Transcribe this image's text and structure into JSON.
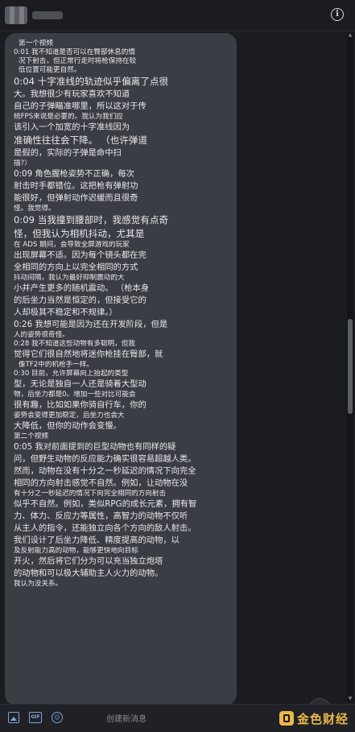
{
  "header": {
    "info_label": "i"
  },
  "message": {
    "lines": [
      {
        "t": "第一个视频",
        "c": "s ind"
      },
      {
        "t": "0:01 我不知道是否可以在臀部休息的情",
        "c": "s"
      },
      {
        "t": "况下射击，但正常行走时将枪保持在较",
        "c": "s ind"
      },
      {
        "t": "低位置可能更自然。",
        "c": "s ind"
      },
      {
        "t": "0:04 十字准线的轨迹似乎偏离了点很",
        "c": "l"
      },
      {
        "t": "大。我想很少有玩家喜欢不知道",
        "c": "m"
      },
      {
        "t": "自己的子弹瞄准哪里，所以这对于传",
        "c": "m"
      },
      {
        "t": "统FPS来说是必要的。我认为我们应",
        "c": "s"
      },
      {
        "t": "该引入一个加宽的十字准线因为",
        "c": "m"
      },
      {
        "t": "准确性往往会下降。  （也许弹道",
        "c": "l"
      },
      {
        "t": "是假的，实际的子弹是命中扫",
        "c": "m"
      },
      {
        "t": "描?）",
        "c": "s"
      },
      {
        "t": "0:09 角色握枪姿势不正确，每次",
        "c": "m"
      },
      {
        "t": "射击时手都错位。这把枪有弹射功",
        "c": "m"
      },
      {
        "t": "能很好，但弹射动作迟缓而且很奇",
        "c": "m"
      },
      {
        "t": "怪。我觉得。",
        "c": "s"
      },
      {
        "t": "0:09 当我撞到腰部时，我感觉有点奇",
        "c": "l"
      },
      {
        "t": "怪，但我认为相机抖动，尤其是",
        "c": "l"
      },
      {
        "t": "在 ADS 期间，会导致全屏游戏的玩家",
        "c": "s"
      },
      {
        "t": "出现屏幕不适。因为每个镜头都在完",
        "c": "m"
      },
      {
        "t": "全相同的方向上以完全相同的方式",
        "c": "m"
      },
      {
        "t": "抖动间隔，我认为最好抑制震动的大",
        "c": "s"
      },
      {
        "t": "小并产生更多的随机震动。  （枪本身",
        "c": "m"
      },
      {
        "t": "的后坐力当然是恒定的，但接受它的",
        "c": "m"
      },
      {
        "t": "人却极其不稳定和不规律。）",
        "c": "m"
      },
      {
        "t": "0:26 我想可能是因为还在开发阶段，但是",
        "c": "m"
      },
      {
        "t": "人的姿势很奇怪。",
        "c": "s"
      },
      {
        "t": "0:28 我不知道这些动物有多聪明，但我",
        "c": "s"
      },
      {
        "t": "觉得它们很自然地将迷你枪挂在臀部，就",
        "c": "m"
      },
      {
        "t": "像TF2中的机枪手一样。",
        "c": "s ind"
      },
      {
        "t": "0:30 目前，允许屏幕向上抬起的类型",
        "c": "s"
      },
      {
        "t": "型，无论是独自一人还是骑着大型动",
        "c": "m"
      },
      {
        "t": "物，后坐力都是0。增加一些对比可能会",
        "c": "s"
      },
      {
        "t": "很有趣，比如如果你骑自行车，你的",
        "c": "m"
      },
      {
        "t": "姿势会变得更加稳定，后坐力也会大",
        "c": "s"
      },
      {
        "t": "大降低，但你的动作会变慢。",
        "c": "m"
      },
      {
        "t": "第二个视频",
        "c": "s"
      },
      {
        "t": "0:05 我对前面提到的巨型动物也有同样的疑",
        "c": "m"
      },
      {
        "t": "问，但野生动物的反应能力确实很容易超越人类。",
        "c": "m"
      },
      {
        "t": "然而，动物在没有十分之一秒延迟的情况下向完全",
        "c": "m"
      },
      {
        "t": "相同的方向射击感觉不自然。例如，让动物在没",
        "c": "m"
      },
      {
        "t": "有十分之一秒延迟的情况下向完全相同的方向射击",
        "c": "s"
      },
      {
        "t": "似乎不自然。例如，类似RPG的成长元素，拥有智",
        "c": "m"
      },
      {
        "t": "力、体力、反应力等属性，高智力的动物不仅听",
        "c": "m"
      },
      {
        "t": "从主人的指令，还能独立向各个方向的敌人射击。",
        "c": "m"
      },
      {
        "t": "我们设计了后坐力降低、精度提高的动物，以",
        "c": "m"
      },
      {
        "t": "及反射能力高的动物，能够更快地向目标",
        "c": "s"
      },
      {
        "t": "开火，然后将它们分为可以充当独立炮塔",
        "c": "m"
      },
      {
        "t": "的动物和可以极大辅助主人火力的动物。",
        "c": "m"
      },
      {
        "t": "我认为没关系。",
        "c": "s"
      }
    ]
  },
  "scroll_button": {
    "label": "↓"
  },
  "composer": {
    "placeholder": "创建新消息",
    "image_icon": "image-icon",
    "gif_icon": "gif-icon",
    "gif_label": "GIF",
    "emoji_icon": "emoji-icon",
    "emoji_label": "☺",
    "brand_text": "金色财经"
  },
  "colors": {
    "background": "#1b1c20",
    "bubble": "#3b3d44",
    "accent": "#7fa7d6",
    "brand": "#e9b949"
  }
}
